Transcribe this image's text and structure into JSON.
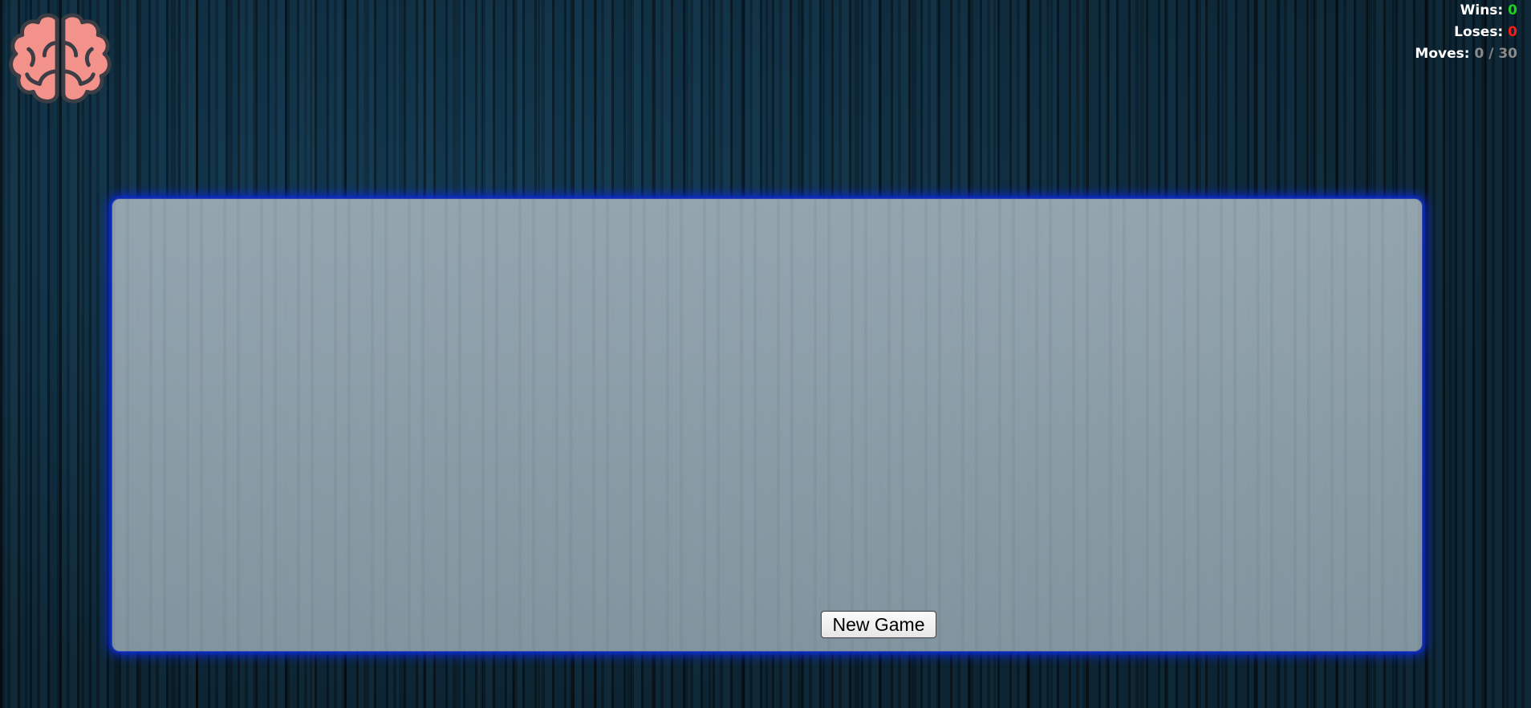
{
  "logo": {
    "icon": "brain-icon",
    "color": "#f2928a"
  },
  "stats": {
    "wins_label": "Wins:",
    "wins_value": "0",
    "loses_label": "Loses:",
    "loses_value": "0",
    "moves_label": "Moves:",
    "moves_value": "0 / 30"
  },
  "board": {
    "new_game_label": "New Game"
  },
  "colors": {
    "wins": "#1fd01f",
    "loses": "#ff1a1a",
    "moves": "#8a8a8a",
    "board_glow": "#0a2bd6"
  }
}
